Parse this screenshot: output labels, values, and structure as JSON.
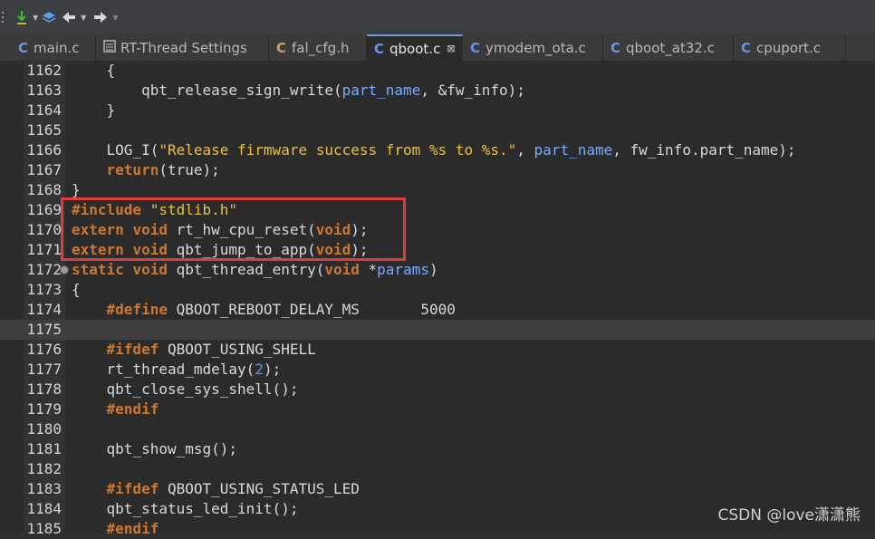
{
  "toolbar": {
    "items": [
      "separator-icon",
      "download-icon",
      "chevron-down-icon",
      "layers-icon",
      "back-arrow-icon",
      "chevron-down-icon",
      "forward-arrow-icon",
      "chevron-down-icon"
    ]
  },
  "tabs": [
    {
      "icon": "C",
      "label": "main.c",
      "active": false
    },
    {
      "icon": "settings",
      "label": "RT-Thread Settings",
      "active": false
    },
    {
      "icon": "C",
      "label": "fal_cfg.h",
      "active": false
    },
    {
      "icon": "C",
      "label": "qboot.c",
      "active": true,
      "close": "⊠"
    },
    {
      "icon": "C",
      "label": "ymodem_ota.c",
      "active": false
    },
    {
      "icon": "C",
      "label": "qboot_at32.c",
      "active": false
    },
    {
      "icon": "C",
      "label": "cpuport.c",
      "active": false
    }
  ],
  "lines": [
    {
      "num": "1162",
      "parts": [
        [
          "plain",
          "    {"
        ]
      ]
    },
    {
      "num": "1163",
      "parts": [
        [
          "plain",
          "        qbt_release_sign_write("
        ],
        [
          "param",
          "part_name"
        ],
        [
          "plain",
          ", &fw_info);"
        ]
      ]
    },
    {
      "num": "1164",
      "parts": [
        [
          "plain",
          "    }"
        ]
      ]
    },
    {
      "num": "1165",
      "parts": []
    },
    {
      "num": "1166",
      "parts": [
        [
          "plain",
          "    LOG_I("
        ],
        [
          "str",
          "\"Release firmware success from %s to %s.\""
        ],
        [
          "plain",
          ", "
        ],
        [
          "param",
          "part_name"
        ],
        [
          "plain",
          ", fw_info.part_name);"
        ]
      ]
    },
    {
      "num": "1167",
      "parts": [
        [
          "plain",
          "    "
        ],
        [
          "kw",
          "return"
        ],
        [
          "plain",
          "(true);"
        ]
      ]
    },
    {
      "num": "1168",
      "parts": [
        [
          "plain",
          "}"
        ]
      ]
    },
    {
      "num": "1169",
      "parts": [
        [
          "kw",
          "#include"
        ],
        [
          "plain",
          " "
        ],
        [
          "str",
          "\"stdlib.h\""
        ]
      ]
    },
    {
      "num": "1170",
      "parts": [
        [
          "kw",
          "extern"
        ],
        [
          "plain",
          " "
        ],
        [
          "kw",
          "void"
        ],
        [
          "plain",
          " rt_hw_cpu_reset("
        ],
        [
          "kw",
          "void"
        ],
        [
          "plain",
          ");"
        ]
      ]
    },
    {
      "num": "1171",
      "parts": [
        [
          "kw",
          "extern"
        ],
        [
          "plain",
          " "
        ],
        [
          "kw",
          "void"
        ],
        [
          "plain",
          " qbt_jump_to_app("
        ],
        [
          "kw",
          "void"
        ],
        [
          "plain",
          ");"
        ]
      ]
    },
    {
      "num": "1172",
      "fold": true,
      "parts": [
        [
          "kw",
          "static"
        ],
        [
          "plain",
          " "
        ],
        [
          "kw",
          "void"
        ],
        [
          "plain",
          " qbt_thread_entry("
        ],
        [
          "kw",
          "void"
        ],
        [
          "plain",
          " *"
        ],
        [
          "param",
          "params"
        ],
        [
          "plain",
          ")"
        ]
      ]
    },
    {
      "num": "1173",
      "parts": [
        [
          "plain",
          "{"
        ]
      ]
    },
    {
      "num": "1174",
      "parts": [
        [
          "plain",
          "    "
        ],
        [
          "kw",
          "#define"
        ],
        [
          "plain",
          " QBOOT_REBOOT_DELAY_MS       5000"
        ]
      ]
    },
    {
      "num": "1175",
      "current": true,
      "parts": []
    },
    {
      "num": "1176",
      "parts": [
        [
          "plain",
          "    "
        ],
        [
          "kw",
          "#ifdef"
        ],
        [
          "plain",
          " QBOOT_USING_SHELL"
        ]
      ]
    },
    {
      "num": "1177",
      "parts": [
        [
          "plain",
          "    rt_thread_mdelay("
        ],
        [
          "num",
          "2"
        ],
        [
          "plain",
          ");"
        ]
      ]
    },
    {
      "num": "1178",
      "parts": [
        [
          "plain",
          "    qbt_close_sys_shell();"
        ]
      ]
    },
    {
      "num": "1179",
      "parts": [
        [
          "plain",
          "    "
        ],
        [
          "kw",
          "#endif"
        ]
      ]
    },
    {
      "num": "1180",
      "parts": []
    },
    {
      "num": "1181",
      "parts": [
        [
          "plain",
          "    qbt_show_msg();"
        ]
      ]
    },
    {
      "num": "1182",
      "parts": []
    },
    {
      "num": "1183",
      "parts": [
        [
          "plain",
          "    "
        ],
        [
          "kw",
          "#ifdef"
        ],
        [
          "plain",
          " QBOOT_USING_STATUS_LED"
        ]
      ]
    },
    {
      "num": "1184",
      "parts": [
        [
          "plain",
          "    qbt_status_led_init();"
        ]
      ]
    },
    {
      "num": "1185",
      "parts": [
        [
          "plain",
          "    "
        ],
        [
          "kw",
          "#endif"
        ]
      ]
    }
  ],
  "watermark": "CSDN @love潇潇熊",
  "colors": {
    "keyword": "#cc7832",
    "string": "#e6c244",
    "param": "#79abff",
    "highlight_box": "#e03c3c"
  }
}
